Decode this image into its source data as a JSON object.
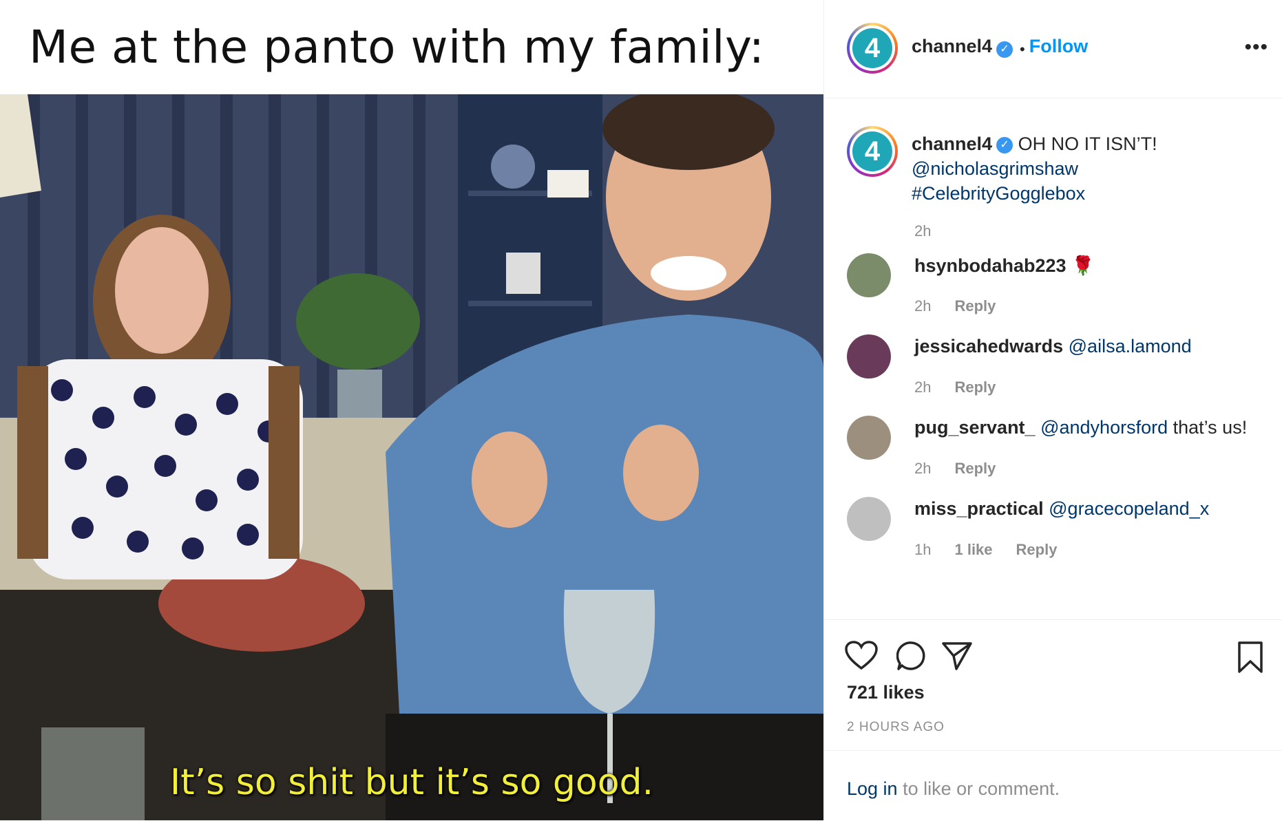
{
  "meme": {
    "caption": "Me at the panto with my family:",
    "subtitle": "It’s so shit but it’s so good."
  },
  "header": {
    "username": "channel4",
    "logo_text": "4",
    "separator": "•",
    "follow_label": "Follow",
    "more_icon": "•••"
  },
  "caption": {
    "username": "channel4",
    "text": "OH NO IT ISN’T!",
    "mention": "@nicholasgrimshaw",
    "hashtag": "#CelebrityGogglebox",
    "time": "2h"
  },
  "comments": [
    {
      "username": "hsynbodahab223",
      "text": "🌹",
      "mention": "",
      "time": "2h",
      "likes": "",
      "reply": "Reply"
    },
    {
      "username": "jessicahedwards",
      "text": "",
      "mention": "@ailsa.lamond",
      "time": "2h",
      "likes": "",
      "reply": "Reply"
    },
    {
      "username": "pug_servant_",
      "text": "that’s us!",
      "mention": "@andyhorsford",
      "time": "2h",
      "likes": "",
      "reply": "Reply"
    },
    {
      "username": "miss_practical",
      "text": "",
      "mention": "@gracecopeland_x",
      "time": "1h",
      "likes": "1 like",
      "reply": "Reply"
    }
  ],
  "actions": {
    "icons": [
      "heart-icon",
      "comment-icon",
      "share-icon",
      "bookmark-icon"
    ],
    "likes": "721 likes",
    "time": "2 HOURS AGO"
  },
  "login": {
    "link": "Log in",
    "text": "to like or comment."
  },
  "colors": {
    "accent": "#0095f6",
    "verified": "#3897f0",
    "link": "#00376b",
    "subtitle": "#f2ef3a"
  }
}
